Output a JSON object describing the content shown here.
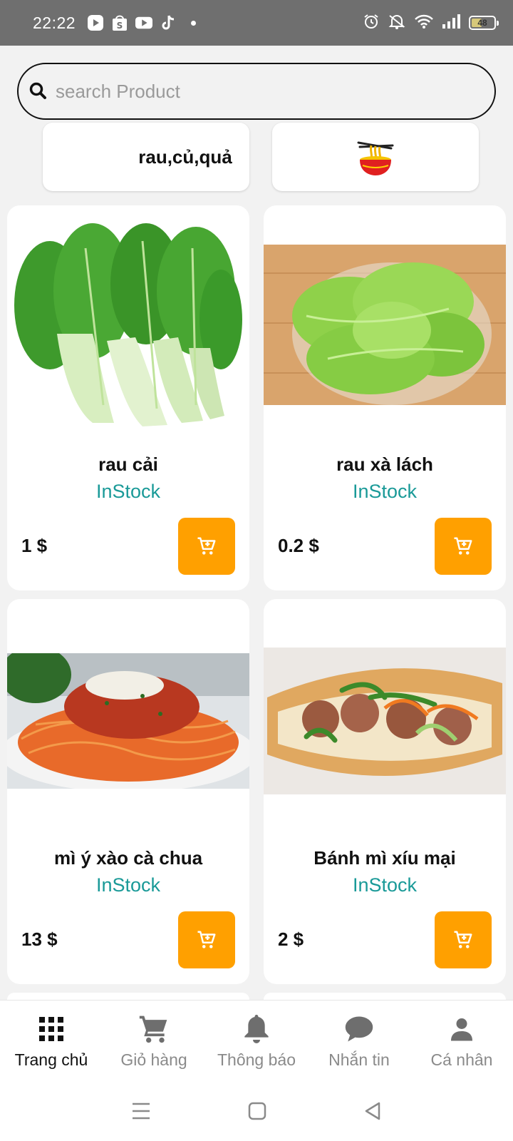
{
  "status_bar": {
    "time": "22:22",
    "battery": "48",
    "battery_level": 0.48,
    "app_icons": [
      "play-icon",
      "shopee-icon",
      "youtube-icon",
      "tiktok-icon"
    ],
    "system_icons": [
      "alarm-icon",
      "mute-icon",
      "wifi-icon",
      "signal-icon",
      "battery-icon"
    ]
  },
  "search": {
    "placeholder": "search Product",
    "value": ""
  },
  "categories": [
    {
      "label": "rau,củ,quả",
      "icon": "vegetable"
    },
    {
      "label": "",
      "icon": "noodle-bowl-icon"
    }
  ],
  "products": [
    {
      "name": "rau cải",
      "stock": "InStock",
      "price": "1 $",
      "image": "bok-choy"
    },
    {
      "name": "rau xà lách",
      "stock": "InStock",
      "price": "0.2 $",
      "image": "lettuce"
    },
    {
      "name": "mì ý xào cà chua",
      "stock": "InStock",
      "price": "13 $",
      "image": "spaghetti"
    },
    {
      "name": "Bánh mì xíu mại",
      "stock": "InStock",
      "price": "2 $",
      "image": "banh-mi"
    }
  ],
  "bottom_nav": [
    {
      "label": "Trang chủ",
      "icon": "grid-icon",
      "active": true
    },
    {
      "label": "Giỏ hàng",
      "icon": "cart-icon",
      "active": false
    },
    {
      "label": "Thông báo",
      "icon": "bell-icon",
      "active": false
    },
    {
      "label": "Nhắn tin",
      "icon": "chat-icon",
      "active": false
    },
    {
      "label": "Cá nhân",
      "icon": "person-icon",
      "active": false
    }
  ],
  "colors": {
    "accent": "#ffa000",
    "stock": "#1a9a98",
    "background": "#f2f2f2",
    "status_bar": "#6f6f6f"
  }
}
